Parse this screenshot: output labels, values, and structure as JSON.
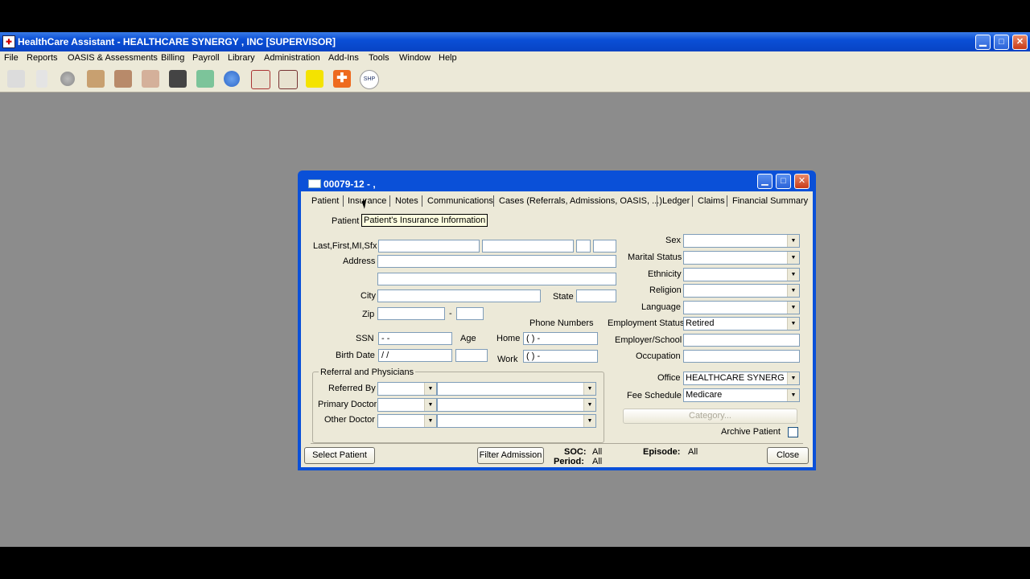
{
  "app": {
    "title": "HealthCare Assistant - HEALTHCARE SYNERGY , INC [SUPERVISOR]",
    "window_buttons": [
      "minimize-icon",
      "maximize-icon",
      "close-icon"
    ]
  },
  "menu": [
    "File",
    "Reports",
    "OASIS & Assessments",
    "Billing",
    "Payroll",
    "Library",
    "Administration",
    "Add-Ins",
    "Tools",
    "Window",
    "Help"
  ],
  "toolbar_icons": [
    "document-icon",
    "blank-page-icon",
    "stop-icon",
    "people-icon",
    "team-icon",
    "calendar-icon",
    "car-icon",
    "checkmark-heart-icon",
    "help-icon",
    "home-icon",
    "house-icon",
    "smiley-icon",
    "medical-cross-icon",
    "shp-icon"
  ],
  "toolbar_shp_label": "SHP",
  "dialog": {
    "title": "00079-12 - ,",
    "tabs": [
      "Patient",
      "Insurance",
      "Notes",
      "Communications",
      "Cases (Referrals, Admissions, OASIS, ...)",
      "Ledger",
      "Claims",
      "Financial Summary"
    ],
    "tooltip": "Patient's Insurance Information",
    "patient_label": "Patient",
    "labels": {
      "name": "Last,First,MI,Sfx",
      "address": "Address",
      "city": "City",
      "state": "State",
      "zip": "Zip",
      "zip_dash": "-",
      "phone_numbers": "Phone Numbers",
      "ssn": "SSN",
      "age": "Age",
      "home": "Home",
      "birth_date": "Birth Date",
      "work": "Work",
      "sex": "Sex",
      "marital_status": "Marital Status",
      "ethnicity": "Ethnicity",
      "religion": "Religion",
      "language": "Language",
      "employment_status": "Employment Status",
      "employer_school": "Employer/School",
      "occupation": "Occupation",
      "office": "Office",
      "fee_schedule": "Fee Schedule",
      "archive_patient": "Archive Patient"
    },
    "values": {
      "ssn": " -  -",
      "birth_date": " /  /",
      "home_phone": "(   )    -",
      "work_phone": "(   )    -",
      "employment_status": "Retired",
      "office": "HEALTHCARE SYNERG",
      "fee_schedule": "Medicare"
    },
    "referral_group": {
      "title": "Referral and Physicians",
      "referred_by": "Referred By",
      "primary_doctor": "Primary Doctor",
      "other_doctor": "Other Doctor"
    },
    "category_button": "Category...",
    "footer": {
      "select_patient": "Select Patient",
      "filter_admission": "Filter Admission",
      "soc_label": "SOC:",
      "soc_value": "All",
      "period_label": "Period:",
      "period_value": "All",
      "episode_label": "Episode:",
      "episode_value": "All",
      "close": "Close"
    }
  }
}
